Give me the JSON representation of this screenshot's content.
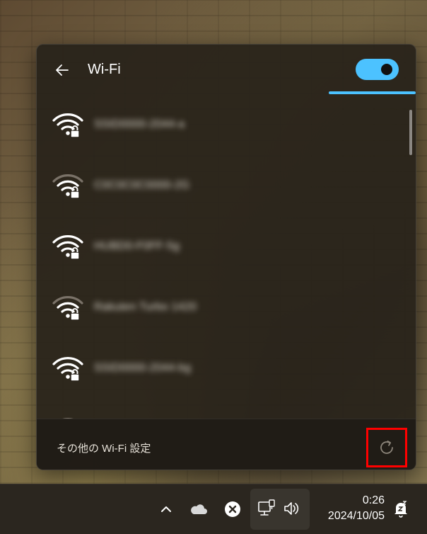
{
  "flyout": {
    "title": "Wi-Fi",
    "wifi_enabled": true,
    "toggle_state": "on",
    "back_icon": "back-arrow-icon",
    "networks": [
      {
        "name": "SSID0000-2044-a",
        "signal": "full",
        "secured": true
      },
      {
        "name": "C0C0C0C0000-2G",
        "signal": "medium",
        "secured": true
      },
      {
        "name": "HUBD0-F0FF-5g",
        "signal": "full",
        "secured": true
      },
      {
        "name": "Rakuten Turbo 1420",
        "signal": "medium",
        "secured": true
      },
      {
        "name": "SSID0000-2044-bg",
        "signal": "full",
        "secured": true
      }
    ],
    "footer": {
      "more_settings_label": "その他の Wi-Fi 設定",
      "refresh_icon": "refresh-icon"
    }
  },
  "taskbar": {
    "tray_icons": [
      "chevron-up-icon",
      "onedrive-cloud-icon",
      "error-x-icon",
      "network-icon",
      "volume-icon",
      "notification-bell-icon"
    ],
    "time": "0:26",
    "date": "2024/10/05"
  },
  "colors": {
    "accent": "#4cc2ff",
    "flyout_bg": "#28221a",
    "highlight_box": "#ff0000"
  }
}
